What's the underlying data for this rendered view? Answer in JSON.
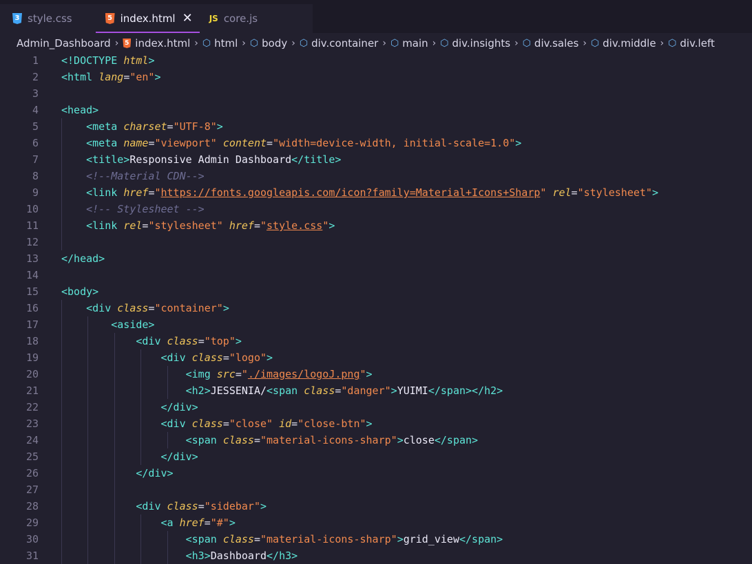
{
  "tabs": [
    {
      "label": "style.css",
      "icon": "css3-icon",
      "active": false
    },
    {
      "label": "index.html",
      "icon": "html5-icon",
      "active": true
    },
    {
      "label": "core.js",
      "icon": "js-icon",
      "active": false
    }
  ],
  "breadcrumb": [
    "Admin_Dashboard",
    "index.html",
    "html",
    "body",
    "div.container",
    "main",
    "div.insights",
    "div.sales",
    "div.middle",
    "div.left"
  ],
  "line_numbers": [
    "1",
    "2",
    "3",
    "4",
    "5",
    "6",
    "7",
    "8",
    "9",
    "10",
    "11",
    "12",
    "13",
    "14",
    "15",
    "16",
    "17",
    "18",
    "19",
    "20",
    "21",
    "22",
    "23",
    "24",
    "25",
    "26",
    "27",
    "28",
    "29",
    "30",
    "31"
  ],
  "colors": {
    "background": "#22202e",
    "tag": "#5ee6d8",
    "attribute": "#f0c45a",
    "value": "#f28a4e",
    "comment": "#6e6d93",
    "accent": "#a64fe0"
  }
}
